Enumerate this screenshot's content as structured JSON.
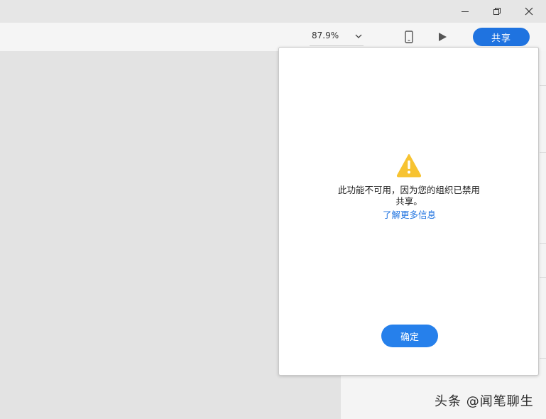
{
  "window": {
    "minimize_icon": "minimize-icon",
    "restore_icon": "restore-icon",
    "close_icon": "close-icon"
  },
  "toolbar": {
    "zoom_value": "87.9%",
    "zoom_dropdown_icon": "chevron-down-icon",
    "device_preview_icon": "mobile-phone-icon",
    "play_icon": "play-icon",
    "share_label": "共享",
    "accent_color": "#1f73e0"
  },
  "dialog": {
    "warning_icon": "warning-triangle-icon",
    "warning_color": "#f7c331",
    "message": "此功能不可用，因为您的组织已禁用共享。",
    "learn_more_link": "了解更多信息",
    "ok_label": "确定"
  },
  "watermark": {
    "text": "头条 @闻笔聊生"
  }
}
